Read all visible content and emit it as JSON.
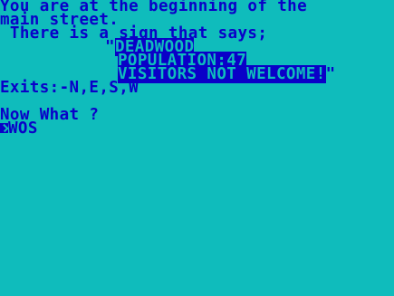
{
  "game": {
    "description_line1": "You are at the beginning of the",
    "description_line2": "main street.",
    "description_line3": " There is a sign that says;",
    "sign_open_quote": "\"",
    "sign_line1": "DEADWOOD",
    "sign_line2": "POPULATION:47",
    "sign_line3": "VISITORS NOT WELCOME!",
    "sign_close_quote": "\"",
    "exits": "Exits:-N,E,S,W",
    "prompt": "Now What ?",
    "command_input": "WOS"
  },
  "colors": {
    "background": "#0fbcbc",
    "ink": "#0a00c8"
  },
  "icons": {
    "cursor": "caret-icon"
  }
}
